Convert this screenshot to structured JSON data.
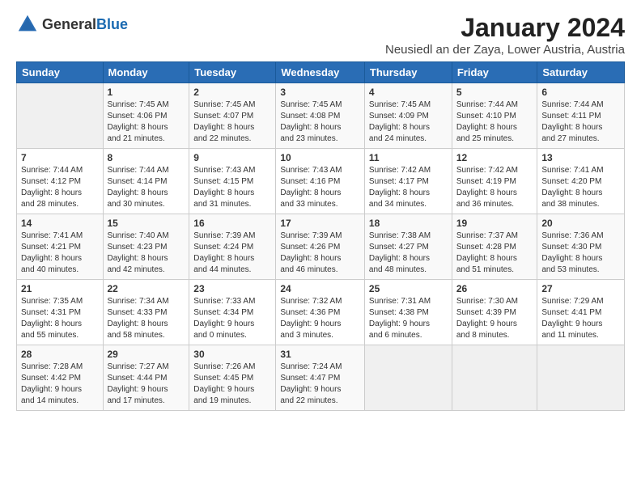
{
  "header": {
    "logo_general": "General",
    "logo_blue": "Blue",
    "title": "January 2024",
    "subtitle": "Neusiedl an der Zaya, Lower Austria, Austria"
  },
  "weekdays": [
    "Sunday",
    "Monday",
    "Tuesday",
    "Wednesday",
    "Thursday",
    "Friday",
    "Saturday"
  ],
  "weeks": [
    [
      {
        "num": "",
        "info": ""
      },
      {
        "num": "1",
        "info": "Sunrise: 7:45 AM\nSunset: 4:06 PM\nDaylight: 8 hours\nand 21 minutes."
      },
      {
        "num": "2",
        "info": "Sunrise: 7:45 AM\nSunset: 4:07 PM\nDaylight: 8 hours\nand 22 minutes."
      },
      {
        "num": "3",
        "info": "Sunrise: 7:45 AM\nSunset: 4:08 PM\nDaylight: 8 hours\nand 23 minutes."
      },
      {
        "num": "4",
        "info": "Sunrise: 7:45 AM\nSunset: 4:09 PM\nDaylight: 8 hours\nand 24 minutes."
      },
      {
        "num": "5",
        "info": "Sunrise: 7:44 AM\nSunset: 4:10 PM\nDaylight: 8 hours\nand 25 minutes."
      },
      {
        "num": "6",
        "info": "Sunrise: 7:44 AM\nSunset: 4:11 PM\nDaylight: 8 hours\nand 27 minutes."
      }
    ],
    [
      {
        "num": "7",
        "info": "Sunrise: 7:44 AM\nSunset: 4:12 PM\nDaylight: 8 hours\nand 28 minutes."
      },
      {
        "num": "8",
        "info": "Sunrise: 7:44 AM\nSunset: 4:14 PM\nDaylight: 8 hours\nand 30 minutes."
      },
      {
        "num": "9",
        "info": "Sunrise: 7:43 AM\nSunset: 4:15 PM\nDaylight: 8 hours\nand 31 minutes."
      },
      {
        "num": "10",
        "info": "Sunrise: 7:43 AM\nSunset: 4:16 PM\nDaylight: 8 hours\nand 33 minutes."
      },
      {
        "num": "11",
        "info": "Sunrise: 7:42 AM\nSunset: 4:17 PM\nDaylight: 8 hours\nand 34 minutes."
      },
      {
        "num": "12",
        "info": "Sunrise: 7:42 AM\nSunset: 4:19 PM\nDaylight: 8 hours\nand 36 minutes."
      },
      {
        "num": "13",
        "info": "Sunrise: 7:41 AM\nSunset: 4:20 PM\nDaylight: 8 hours\nand 38 minutes."
      }
    ],
    [
      {
        "num": "14",
        "info": "Sunrise: 7:41 AM\nSunset: 4:21 PM\nDaylight: 8 hours\nand 40 minutes."
      },
      {
        "num": "15",
        "info": "Sunrise: 7:40 AM\nSunset: 4:23 PM\nDaylight: 8 hours\nand 42 minutes."
      },
      {
        "num": "16",
        "info": "Sunrise: 7:39 AM\nSunset: 4:24 PM\nDaylight: 8 hours\nand 44 minutes."
      },
      {
        "num": "17",
        "info": "Sunrise: 7:39 AM\nSunset: 4:26 PM\nDaylight: 8 hours\nand 46 minutes."
      },
      {
        "num": "18",
        "info": "Sunrise: 7:38 AM\nSunset: 4:27 PM\nDaylight: 8 hours\nand 48 minutes."
      },
      {
        "num": "19",
        "info": "Sunrise: 7:37 AM\nSunset: 4:28 PM\nDaylight: 8 hours\nand 51 minutes."
      },
      {
        "num": "20",
        "info": "Sunrise: 7:36 AM\nSunset: 4:30 PM\nDaylight: 8 hours\nand 53 minutes."
      }
    ],
    [
      {
        "num": "21",
        "info": "Sunrise: 7:35 AM\nSunset: 4:31 PM\nDaylight: 8 hours\nand 55 minutes."
      },
      {
        "num": "22",
        "info": "Sunrise: 7:34 AM\nSunset: 4:33 PM\nDaylight: 8 hours\nand 58 minutes."
      },
      {
        "num": "23",
        "info": "Sunrise: 7:33 AM\nSunset: 4:34 PM\nDaylight: 9 hours\nand 0 minutes."
      },
      {
        "num": "24",
        "info": "Sunrise: 7:32 AM\nSunset: 4:36 PM\nDaylight: 9 hours\nand 3 minutes."
      },
      {
        "num": "25",
        "info": "Sunrise: 7:31 AM\nSunset: 4:38 PM\nDaylight: 9 hours\nand 6 minutes."
      },
      {
        "num": "26",
        "info": "Sunrise: 7:30 AM\nSunset: 4:39 PM\nDaylight: 9 hours\nand 8 minutes."
      },
      {
        "num": "27",
        "info": "Sunrise: 7:29 AM\nSunset: 4:41 PM\nDaylight: 9 hours\nand 11 minutes."
      }
    ],
    [
      {
        "num": "28",
        "info": "Sunrise: 7:28 AM\nSunset: 4:42 PM\nDaylight: 9 hours\nand 14 minutes."
      },
      {
        "num": "29",
        "info": "Sunrise: 7:27 AM\nSunset: 4:44 PM\nDaylight: 9 hours\nand 17 minutes."
      },
      {
        "num": "30",
        "info": "Sunrise: 7:26 AM\nSunset: 4:45 PM\nDaylight: 9 hours\nand 19 minutes."
      },
      {
        "num": "31",
        "info": "Sunrise: 7:24 AM\nSunset: 4:47 PM\nDaylight: 9 hours\nand 22 minutes."
      },
      {
        "num": "",
        "info": ""
      },
      {
        "num": "",
        "info": ""
      },
      {
        "num": "",
        "info": ""
      }
    ]
  ]
}
